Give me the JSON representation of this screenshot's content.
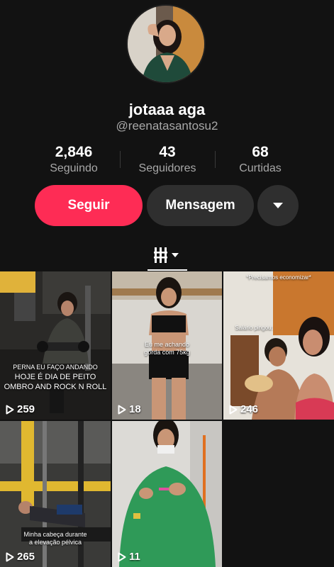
{
  "profile": {
    "display_name": "jotaaa aga",
    "username": "@reenatasantosu2"
  },
  "stats": {
    "following": {
      "value": "2,846",
      "label": "Seguindo"
    },
    "followers": {
      "value": "43",
      "label": "Seguidores"
    },
    "likes": {
      "value": "68",
      "label": "Curtidas"
    }
  },
  "actions": {
    "follow_label": "Seguir",
    "message_label": "Mensagem",
    "more_icon": "caret-down-icon"
  },
  "tabs": {
    "active_icon": "videos-grid-icon"
  },
  "colors": {
    "background": "#121212",
    "follow_button": "#fe2c55",
    "secondary_button": "#2f2f2f",
    "muted_text": "#a8a8a8"
  },
  "videos": [
    {
      "views": "259",
      "caption": "PERNA EU FAÇO ANDANDO",
      "caption2": "HOJE É DIA DE PEITO",
      "caption3": "OMBRO AND ROCK N ROLL"
    },
    {
      "views": "18",
      "caption": "Eu me achando",
      "caption2": "gorda com 75kg"
    },
    {
      "views": "246",
      "caption": "*Precisamos economizar*",
      "caption2": "Salário pingou:"
    },
    {
      "views": "265",
      "caption": "Minha cabeça durante",
      "caption2": "a elevação pélvica"
    },
    {
      "views": "11"
    }
  ]
}
